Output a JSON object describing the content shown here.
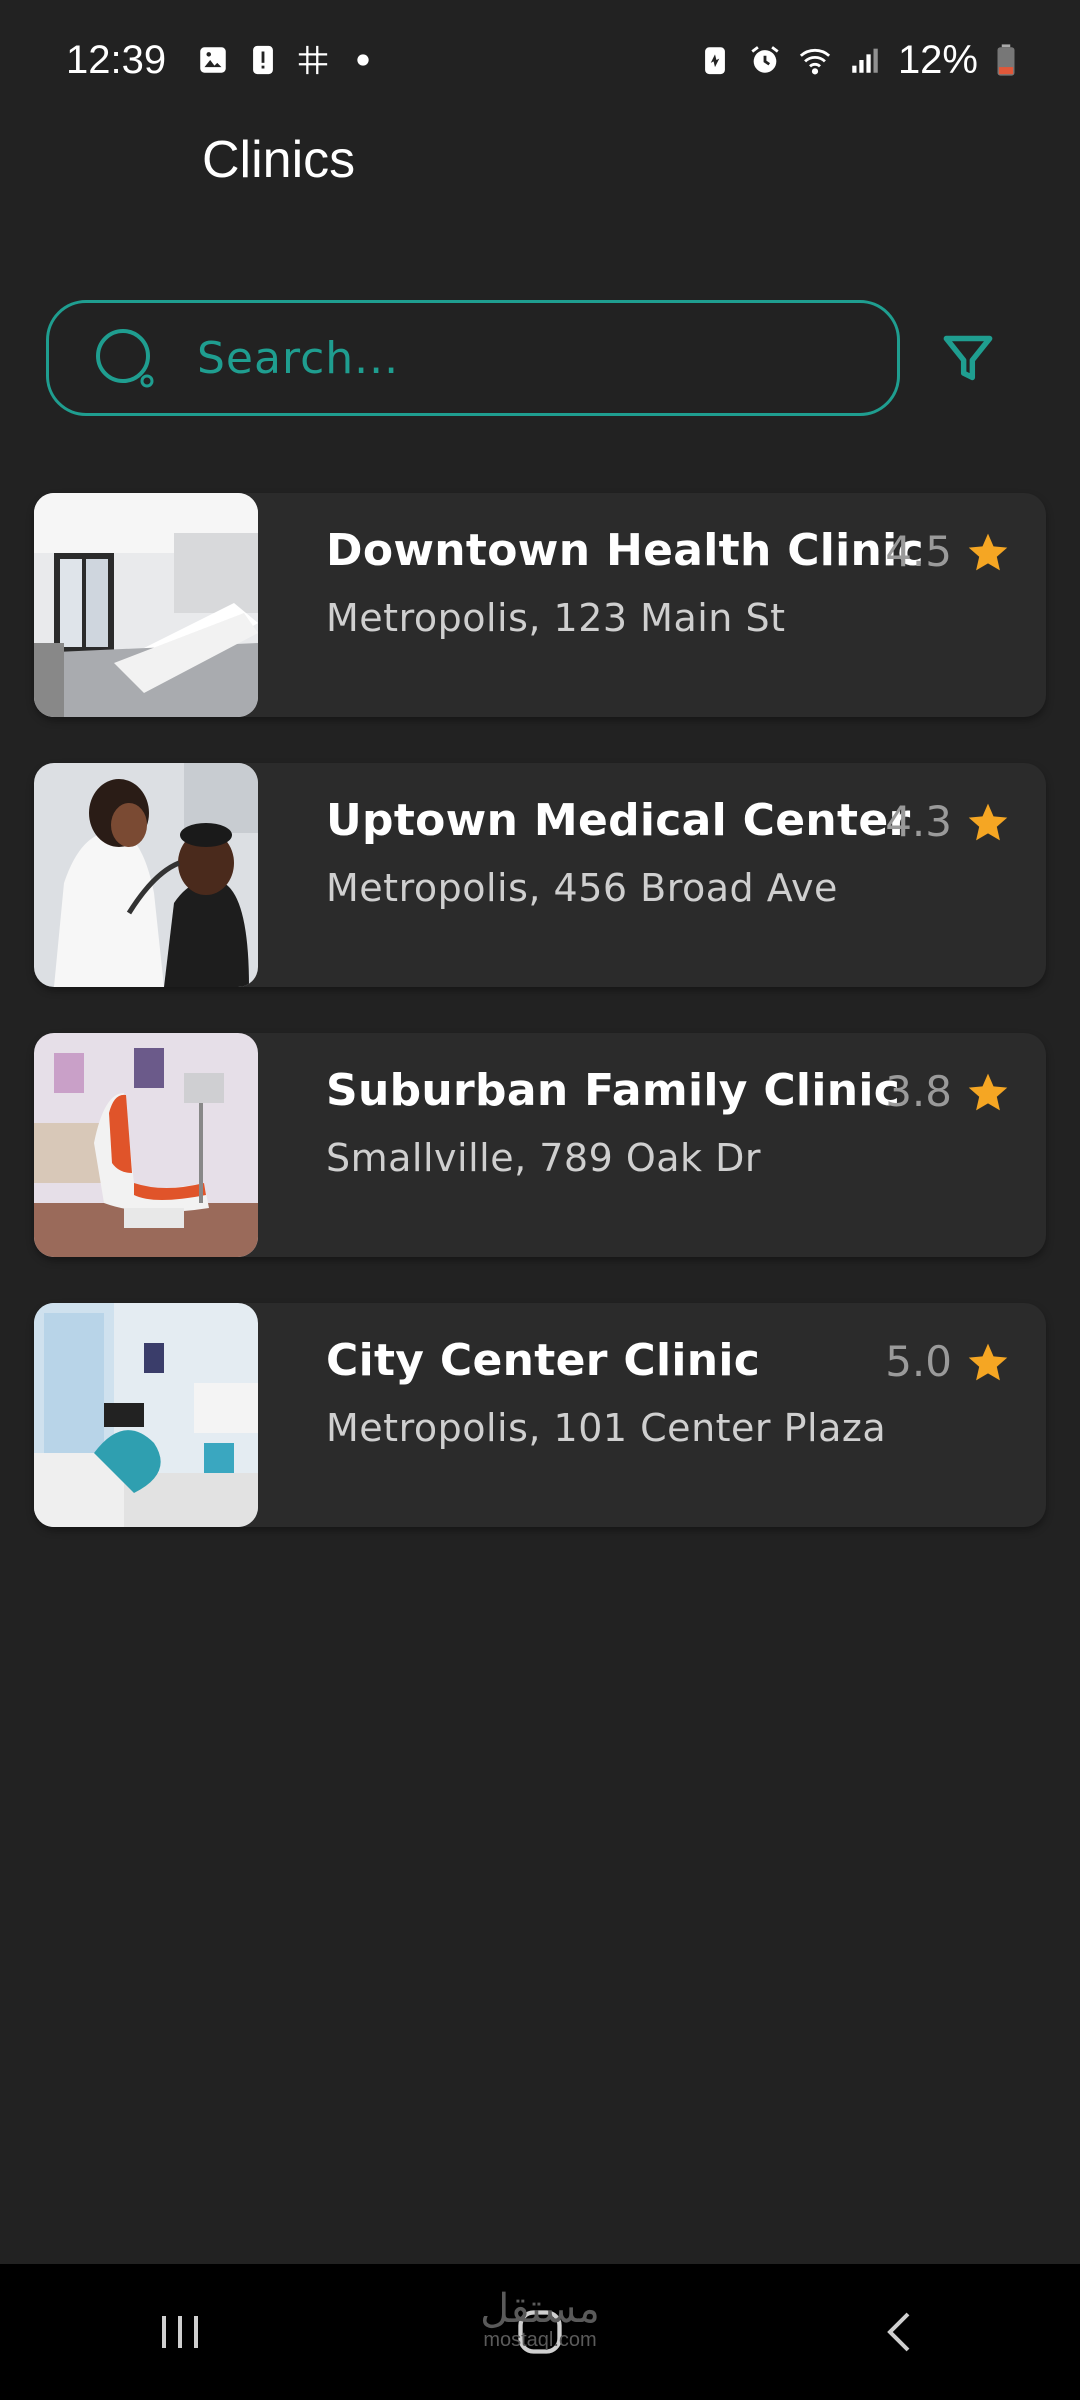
{
  "status_bar": {
    "time": "12:39",
    "battery_percent": "12%",
    "left_icons": [
      "gallery-icon",
      "alert-icon",
      "grid-app-icon",
      "dot-icon"
    ],
    "right_icons": [
      "battery-saver-icon",
      "alarm-icon",
      "wifi-icon",
      "signal-icon",
      "battery-icon"
    ]
  },
  "header": {
    "title": "Clinics"
  },
  "search": {
    "placeholder": "Search...",
    "value": ""
  },
  "colors": {
    "background": "#222222",
    "card": "#2b2b2b",
    "accent": "#1f9e90",
    "star": "#f5a623",
    "rating_text": "#9a9a9a"
  },
  "clinics": [
    {
      "name": "Downtown Health Clinic",
      "address": "Metropolis, 123 Main St",
      "rating": "4.5"
    },
    {
      "name": "Uptown Medical Center",
      "address": "Metropolis, 456 Broad Ave",
      "rating": "4.3"
    },
    {
      "name": "Suburban Family Clinic",
      "address": "Smallville, 789 Oak Dr",
      "rating": "3.8"
    },
    {
      "name": "City Center Clinic",
      "address": "Metropolis, 101 Center Plaza",
      "rating": "5.0"
    }
  ],
  "watermark": {
    "arabic": "مستقل",
    "latin": "mostaql.com"
  },
  "nav": [
    "recent-apps-icon",
    "home-icon",
    "back-icon"
  ]
}
